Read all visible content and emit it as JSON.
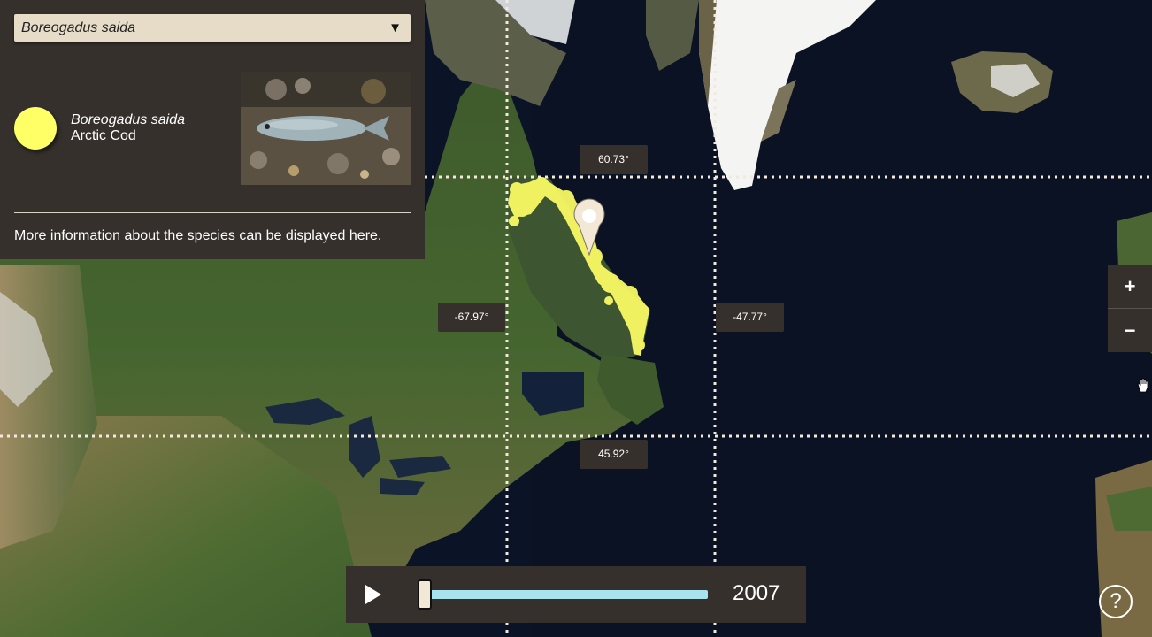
{
  "species_select": {
    "value": "Boreogadus saida",
    "arrow": "▼"
  },
  "species": {
    "scientific_name": "Boreogadus saida",
    "common_name": "Arctic Cod",
    "color": "#ffff66",
    "info_text": "More information about the species can be displayed here."
  },
  "bounds": {
    "north": "60.73°",
    "south": "45.92°",
    "west": "-67.97°",
    "east": "-47.77°"
  },
  "zoom": {
    "in_label": "+",
    "out_label": "−"
  },
  "timeline": {
    "year": "2007",
    "progress": 0
  },
  "help_label": "?",
  "icons": [
    "play-icon",
    "map-pin-icon",
    "hand-cursor-icon",
    "help-icon"
  ]
}
